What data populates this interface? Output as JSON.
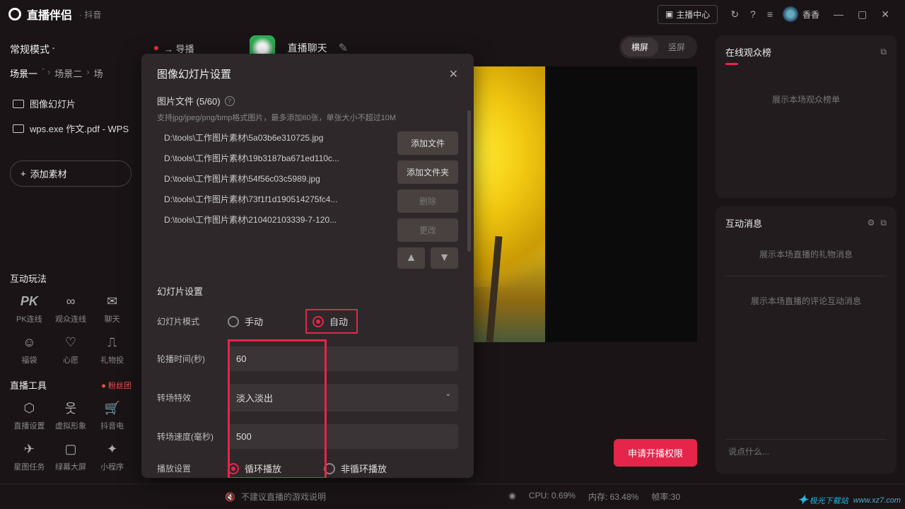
{
  "titlebar": {
    "app_name": "直播伴侣",
    "sub": "· 抖音",
    "broadcast_center": "主播中心",
    "username": "香香"
  },
  "sidebar": {
    "mode": "常规模式",
    "scenes": [
      "场景一",
      "场景二",
      "场"
    ],
    "item_slideshow": "图像幻灯片",
    "item_file": "wps.exe 作文.pdf - WPS",
    "add_source": "添加素材",
    "section_interact": "互动玩法",
    "tools": {
      "pk": "PK连线",
      "audience": "观众连线",
      "chat": "聊天",
      "fudai": "福袋",
      "wish": "心愿",
      "gift": "礼物投"
    },
    "section_live": "直播工具",
    "fans_badge": "粉丝团",
    "live_tools": {
      "settings": "直播设置",
      "avatar": "虚拟形象",
      "dyshop": "抖音电",
      "startask": "星图任务",
      "greenscreen": "绿幕大屏",
      "miniapp": "小程序"
    }
  },
  "center": {
    "cast_link": "导播",
    "cast_title": "直播聊天",
    "orient_h": "横屏",
    "orient_v": "竖屏",
    "apply_btn": "申请开播权限"
  },
  "right": {
    "viewers_title": "在线观众榜",
    "viewers_empty": "展示本场观众榜单",
    "msg_title": "互动消息",
    "msg_gift": "展示本场直播的礼物消息",
    "msg_comment": "展示本场直播的评论互动消息",
    "input_ph": "说点什么..."
  },
  "status": {
    "warn": "不建议直播的游戏说明",
    "cpu": "CPU: 0.69%",
    "mem": "内存: 63.48%",
    "fps": "帧率:30"
  },
  "modal": {
    "title": "图像幻灯片设置",
    "files_label": "图片文件 (5/60)",
    "files_hint": "支持jpg/jpeg/png/bmp格式图片，最多添加60张，单张大小不超过10M",
    "files": [
      "D:\\tools\\工作图片素材\\5a03b6e310725.jpg",
      "D:\\tools\\工作图片素材\\19b3187ba671ed110c...",
      "D:\\tools\\工作图片素材\\54f56c03c5989.jpg",
      "D:\\tools\\工作图片素材\\73f1f1d190514275fc4...",
      "D:\\tools\\工作图片素材\\210402103339-7-120..."
    ],
    "btn_addfile": "添加文件",
    "btn_addfolder": "添加文件夹",
    "btn_delete": "删除",
    "btn_modify": "更改",
    "section_slide": "幻灯片设置",
    "lbl_mode": "幻灯片模式",
    "mode_manual": "手动",
    "mode_auto": "自动",
    "lbl_interval": "轮播时间(秒)",
    "val_interval": "60",
    "lbl_transition": "转场特效",
    "val_transition": "淡入淡出",
    "lbl_speed": "转场速度(毫秒)",
    "val_speed": "500",
    "lbl_play": "播放设置",
    "play_loop": "循环播放",
    "play_noloop": "非循环播放"
  },
  "watermark": {
    "brand": "极光下载站",
    "url": "www.xz7.com"
  }
}
